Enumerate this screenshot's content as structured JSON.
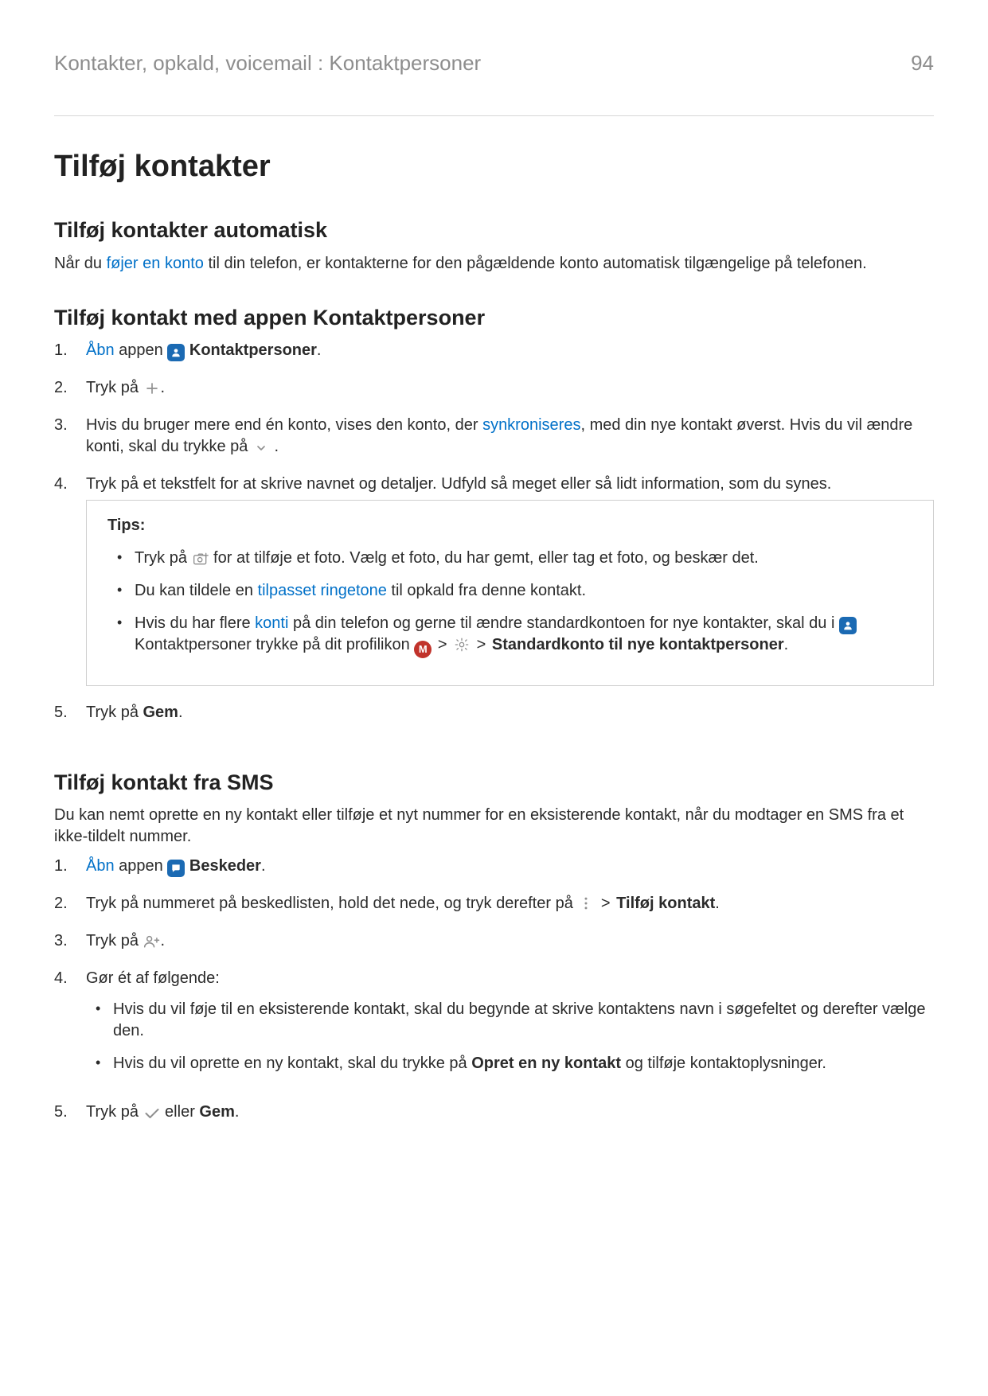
{
  "header": {
    "breadcrumb": "Kontakter, opkald, voicemail : Kontaktpersoner",
    "page_number": "94"
  },
  "title": "Tilføj kontakter",
  "sec_auto": {
    "heading": "Tilføj kontakter automatisk",
    "p_a": "Når du ",
    "p_link": "føjer en konto",
    "p_b": " til din telefon, er kontakterne for den pågældende konto automatisk tilgængelige på telefonen."
  },
  "sec_app": {
    "heading": "Tilføj kontakt med appen Kontaktpersoner",
    "s1_link": "Åbn",
    "s1_a": " appen ",
    "s1_app": "Kontaktpersoner",
    "s1_end": ".",
    "s2_a": "Tryk på ",
    "s2_end": ".",
    "s3_a": "Hvis du bruger mere end én konto, vises den konto, der ",
    "s3_link": "synkroniseres",
    "s3_b": ", med din nye kontakt øverst. Hvis du vil ændre konti, skal du trykke på ",
    "s3_end": " .",
    "s4": "Tryk på et tekstfelt for at skrive navnet og detaljer. Udfyld så meget eller så lidt information, som du synes.",
    "tips_label": "Tips:",
    "b1_a": "Tryk på ",
    "b1_b": " for at tilføje et foto. Vælg et foto, du har gemt, eller tag et foto, og beskær det.",
    "b2_a": "Du kan tildele en ",
    "b2_link": "tilpasset ringetone",
    "b2_b": " til opkald fra denne kontakt.",
    "b3_a": "Hvis du har flere ",
    "b3_link": "konti",
    "b3_b": " på din telefon og gerne til ændre standardkontoen for nye kontakter, skal du i ",
    "b3_app": " Kontaktpersoner trykke på dit profilikon ",
    "b3_gt1": " > ",
    "b3_gt2": " > ",
    "b3_bold": "Standardkonto til nye kontaktpersoner",
    "b3_end": ".",
    "s5_a": "Tryk på ",
    "s5_bold": "Gem",
    "s5_end": "."
  },
  "sec_sms": {
    "heading": "Tilføj kontakt fra SMS",
    "intro": "Du kan nemt oprette en ny kontakt eller tilføje et nyt nummer for en eksisterende kontakt, når du modtager en SMS fra et ikke-tildelt nummer.",
    "s1_link": "Åbn",
    "s1_a": " appen ",
    "s1_app": "Beskeder",
    "s1_end": ".",
    "s2_a": "Tryk på nummeret på beskedlisten, hold det nede, og tryk derefter på ",
    "s2_gt": " > ",
    "s2_bold": "Tilføj kontakt",
    "s2_end": ".",
    "s3_a": "Tryk på ",
    "s3_end": ".",
    "s4": "Gør ét af følgende:",
    "b1": "Hvis du vil føje til en eksisterende kontakt, skal du begynde at skrive kontaktens navn i søgefeltet og derefter vælge den.",
    "b2_a": "Hvis du vil oprette en ny kontakt, skal du trykke på ",
    "b2_bold": "Opret en ny kontakt",
    "b2_b": " og tilføje kontaktoplysninger.",
    "s5_a": "Tryk på ",
    "s5_b": " eller ",
    "s5_bold": "Gem",
    "s5_end": "."
  },
  "nums": {
    "n1": "1.",
    "n2": "2.",
    "n3": "3.",
    "n4": "4.",
    "n5": "5."
  },
  "icons": {
    "profile_letter": "M"
  }
}
